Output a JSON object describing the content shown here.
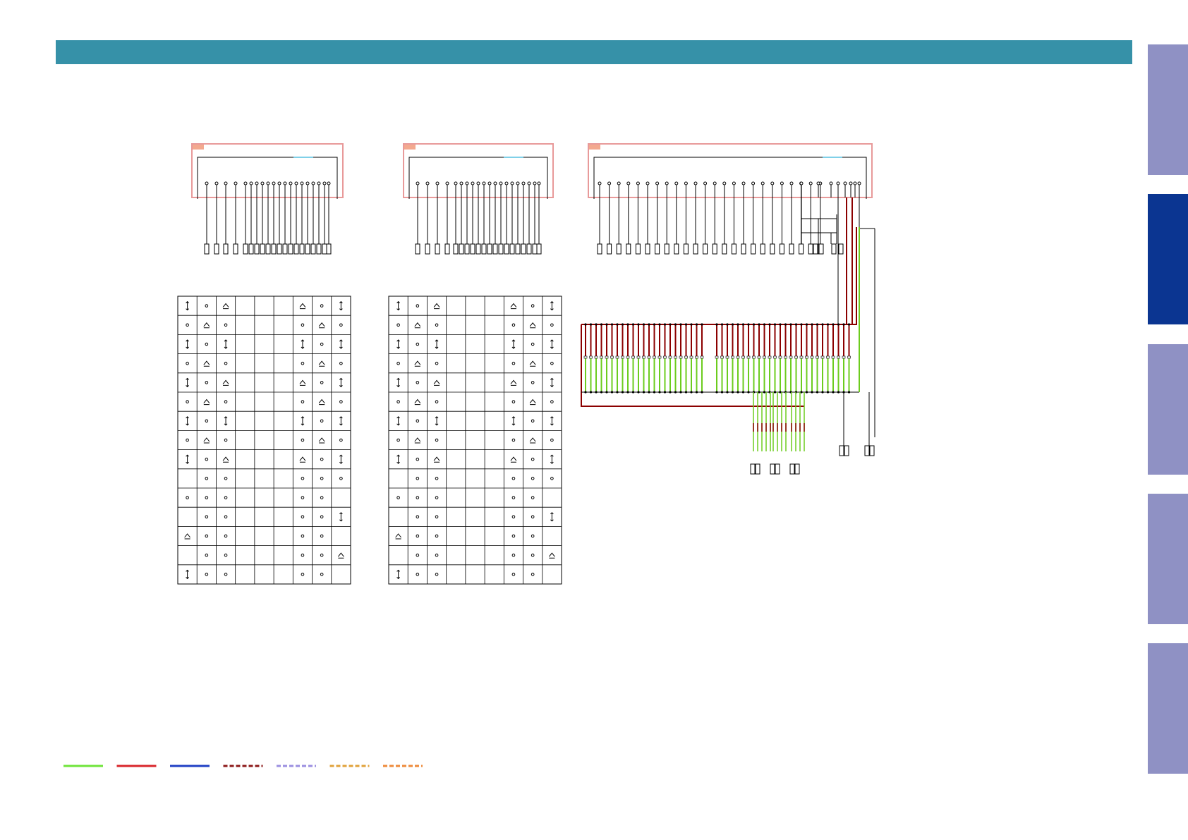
{
  "header": {
    "color": "#3691a8"
  },
  "side_tabs": [
    {
      "id": "tab-1",
      "active": false
    },
    {
      "id": "tab-2",
      "active": true
    },
    {
      "id": "tab-3",
      "active": false
    },
    {
      "id": "tab-4",
      "active": false
    },
    {
      "id": "tab-5",
      "active": false
    }
  ],
  "colors": {
    "tab_inactive": "#8f91c4",
    "tab_active": "#0b3591",
    "box_outline": "#e89a9a",
    "box_corner": "#f3a98f",
    "label_accent": "#7fd0e8",
    "wire": "#000000",
    "trace_red": "#8b0000",
    "trace_green": "#6ccc1e"
  },
  "legend": [
    {
      "name": "legend-green-solid",
      "color": "#6fe43a",
      "style": "solid"
    },
    {
      "name": "legend-red-solid",
      "color": "#d9262b",
      "style": "solid"
    },
    {
      "name": "legend-blue-solid",
      "color": "#1f3fc4",
      "style": "solid"
    },
    {
      "name": "legend-darkred-dashed",
      "color": "#8b1818",
      "style": "dashed"
    },
    {
      "name": "legend-lavender-dashed",
      "color": "#9b8fe0",
      "style": "dashed"
    },
    {
      "name": "legend-orange-dashed",
      "color": "#e0a23a",
      "style": "dashed"
    },
    {
      "name": "legend-orange2-dashed",
      "color": "#ee8a3a",
      "style": "dashed"
    }
  ],
  "connector_pin_counts": [
    16,
    16,
    24
  ],
  "grid_tables": {
    "rows": 15,
    "cols": 9,
    "cells": [
      [
        "v",
        "o",
        "c",
        "",
        "",
        "c",
        "o",
        "v"
      ],
      [
        "o",
        "c",
        "o",
        "",
        "",
        "o",
        "c",
        "o"
      ],
      [
        "v",
        "o",
        "v",
        "",
        "",
        "v",
        "o",
        "v"
      ],
      [
        "o",
        "c",
        "o",
        "",
        "",
        "o",
        "c",
        "o"
      ],
      [
        "v",
        "o",
        "c",
        "",
        "",
        "c",
        "o",
        "v"
      ],
      [
        "o",
        "c",
        "o",
        "",
        "",
        "o",
        "c",
        "o"
      ],
      [
        "v",
        "o",
        "v",
        "",
        "",
        "v",
        "o",
        "v"
      ],
      [
        "o",
        "c",
        "o",
        "",
        "",
        "o",
        "c",
        "o"
      ],
      [
        "v",
        "o",
        "c",
        "",
        "",
        "c",
        "o",
        "v"
      ],
      [
        "",
        "o",
        "o",
        "",
        "",
        "o",
        "o",
        "o"
      ],
      [
        "o",
        "o",
        "o",
        "",
        "",
        "o",
        "o",
        ""
      ],
      [
        "",
        "o",
        "o",
        "",
        "",
        "o",
        "o",
        "v"
      ],
      [
        "c",
        "o",
        "o",
        "",
        "",
        "o",
        "o",
        ""
      ],
      [
        "",
        "o",
        "o",
        "",
        "",
        "o",
        "o",
        "c"
      ],
      [
        "v",
        "o",
        "o",
        "",
        "",
        "o",
        "o",
        ""
      ]
    ]
  }
}
